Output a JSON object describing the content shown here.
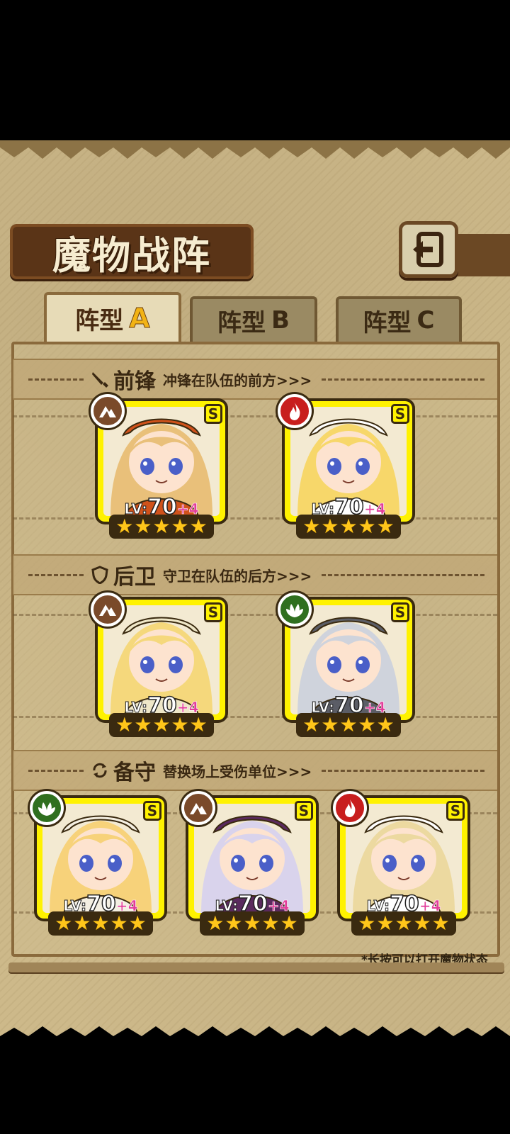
{
  "title": "魔物战阵",
  "back_button": {
    "icon": "back-arrow-icon"
  },
  "tabs": [
    {
      "prefix": "阵型",
      "letter": "A",
      "active": true
    },
    {
      "prefix": "阵型",
      "letter": "B",
      "active": false
    },
    {
      "prefix": "阵型",
      "letter": "C",
      "active": false
    }
  ],
  "sections": {
    "front": {
      "icon": "sword-icon",
      "title": "前锋",
      "desc": "冲锋在队伍的前方>>>"
    },
    "back": {
      "icon": "shield-icon",
      "title": "后卫",
      "desc": "守卫在队伍的后方>>>"
    },
    "reserve": {
      "icon": "swap-icon",
      "title": "备守",
      "desc": "替换场上受伤单位>>>"
    }
  },
  "cards": [
    {
      "element": "earth",
      "element_color": "#7a4a2a",
      "rank": "S",
      "lv_label": "LV:",
      "level": "70",
      "plus": "+4",
      "stars": 5,
      "hair": "#e9c07a",
      "hood": "#d0521b"
    },
    {
      "element": "fire",
      "element_color": "#c81e1e",
      "rank": "S",
      "lv_label": "LV:",
      "level": "70",
      "plus": "+4",
      "stars": 5,
      "hair": "#f7d76a",
      "hood": "#ffffff"
    },
    {
      "element": "earth",
      "element_color": "#7a4a2a",
      "rank": "S",
      "lv_label": "LV:",
      "level": "70",
      "plus": "+4",
      "stars": 5,
      "hair": "#f5d87c",
      "hood": "#efe7c8"
    },
    {
      "element": "wood",
      "element_color": "#2f6f1f",
      "rank": "S",
      "lv_label": "LV:",
      "level": "70",
      "plus": "+4",
      "stars": 5,
      "hair": "#cfd3dc",
      "hood": "#5b5d66"
    },
    {
      "element": "wood",
      "element_color": "#2f6f1f",
      "rank": "S",
      "lv_label": "LV:",
      "level": "70",
      "plus": "+4",
      "stars": 5,
      "hair": "#f7d27a",
      "hood": "#f4efe2"
    },
    {
      "element": "earth",
      "element_color": "#7a4a2a",
      "rank": "S",
      "lv_label": "LV:",
      "level": "70",
      "plus": "+4",
      "stars": 5,
      "hair": "#d9d3ec",
      "hood": "#5a2a5e"
    },
    {
      "element": "fire",
      "element_color": "#c81e1e",
      "rank": "S",
      "lv_label": "LV:",
      "level": "70",
      "plus": "+4",
      "stars": 5,
      "hair": "#ecd9a0",
      "hood": "#ffffff"
    }
  ],
  "hint": "*长按可以打开魔物状态"
}
